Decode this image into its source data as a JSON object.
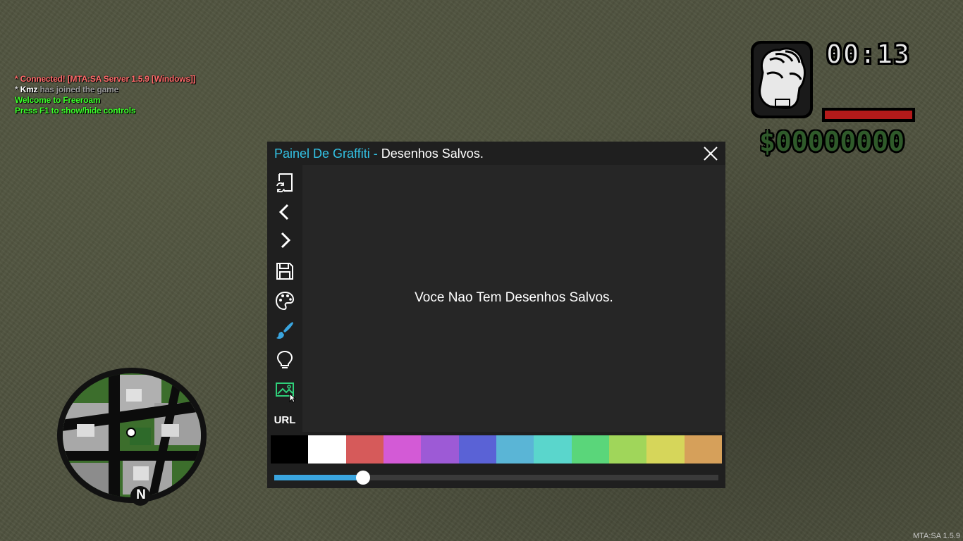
{
  "chat": {
    "line1": "* Connected! [MTA:SA Server 1.5.9 [Windows]]",
    "line2_star": "* ",
    "line2_name": "Kmz",
    "line2_text": " has joined the game",
    "line3": "Welcome to Freeroam",
    "line4": "Press F1 to show/hide controls"
  },
  "hud": {
    "weapon_icon": "fist-icon",
    "clock": "00:13",
    "health_fraction": 1.0,
    "money": "$00000000",
    "colors": {
      "health": "#b41a1a",
      "money": "#2f5a2a"
    }
  },
  "minimap": {
    "north_label": "N"
  },
  "panel": {
    "title_part1": "Painel De Graffiti - ",
    "title_part2": "Desenhos Salvos.",
    "empty_message": "Voce Nao Tem Desenhos Salvos.",
    "sidebar": [
      {
        "icon": "refresh-document-icon"
      },
      {
        "icon": "chevron-left-icon"
      },
      {
        "icon": "chevron-right-icon"
      },
      {
        "icon": "save-icon"
      },
      {
        "icon": "palette-icon"
      },
      {
        "icon": "brush-icon"
      },
      {
        "icon": "lightbulb-icon"
      },
      {
        "icon": "image-icon"
      },
      {
        "label": "URL"
      }
    ],
    "palette_colors": [
      "#000000",
      "#ffffff",
      "#d65a5a",
      "#d35ad6",
      "#9d5ad6",
      "#5a62d6",
      "#5ab5d6",
      "#5ad6cc",
      "#5ad67a",
      "#a0d65a",
      "#d6d65a",
      "#d6a05a"
    ],
    "brush_size_fraction": 0.2,
    "colors": {
      "title_accent": "#33c3e6",
      "slider_fill": "#3aa5df"
    }
  },
  "version": "MTA:SA 1.5.9"
}
